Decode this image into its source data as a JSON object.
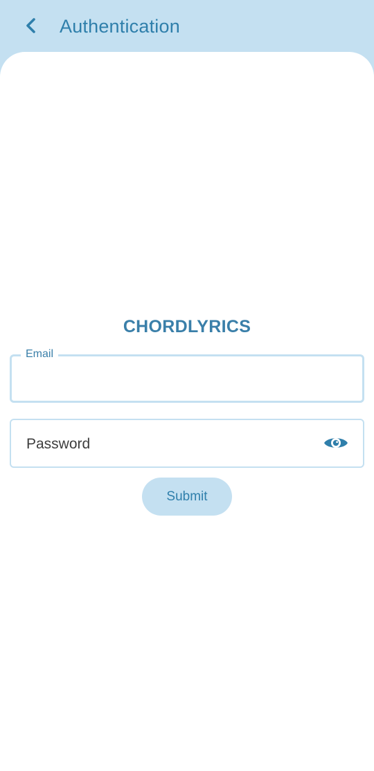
{
  "appbar": {
    "title": "Authentication",
    "back_icon": "chevron-left-icon"
  },
  "brand": {
    "name": "CHORDLYRICS"
  },
  "form": {
    "email": {
      "label": "Email",
      "value": ""
    },
    "password": {
      "placeholder": "Password",
      "value": "",
      "toggle_icon": "eye-icon"
    },
    "submit_label": "Submit"
  },
  "colors": {
    "accent": "#2f7fab",
    "surface_tint": "#c4e0f1",
    "background": "#ffffff"
  }
}
